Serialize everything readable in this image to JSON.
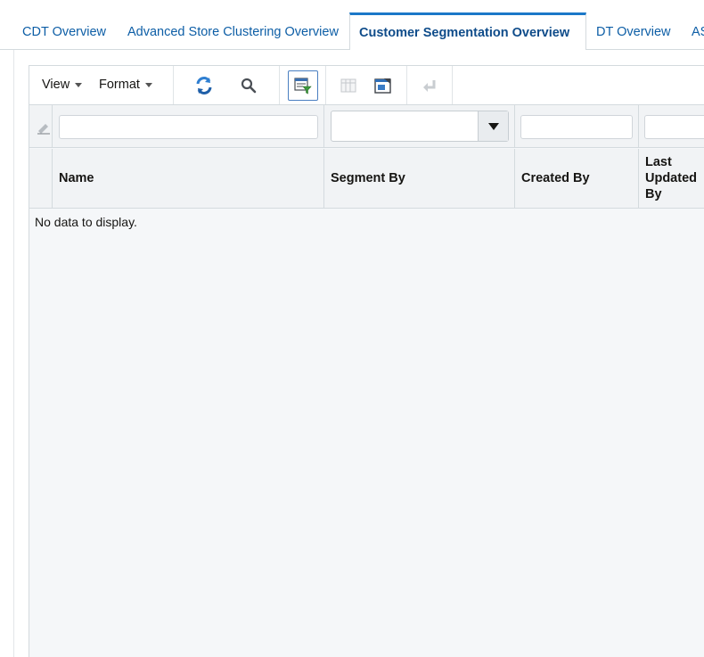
{
  "tabs": [
    {
      "label": "CDT Overview",
      "active": false
    },
    {
      "label": "Advanced Store Clustering Overview",
      "active": false
    },
    {
      "label": "Customer Segmentation Overview",
      "active": true
    },
    {
      "label": "DT Overview",
      "active": false
    },
    {
      "label": "AS",
      "active": false
    }
  ],
  "toolbar": {
    "view_label": "View",
    "format_label": "Format",
    "icons": [
      "refresh-icon",
      "search-icon",
      "query-by-example-icon",
      "freeze-icon",
      "detach-icon",
      "wrap-icon"
    ]
  },
  "table": {
    "columns": [
      "Name",
      "Segment By",
      "Created By",
      "Last Updated By"
    ],
    "last_col_lines": [
      "Last",
      "Updated",
      "By"
    ],
    "empty_message": "No data to display."
  },
  "colors": {
    "accent": "#1b78c8",
    "tab_text": "#0d5ea6",
    "header_bg": "#f1f3f5"
  }
}
